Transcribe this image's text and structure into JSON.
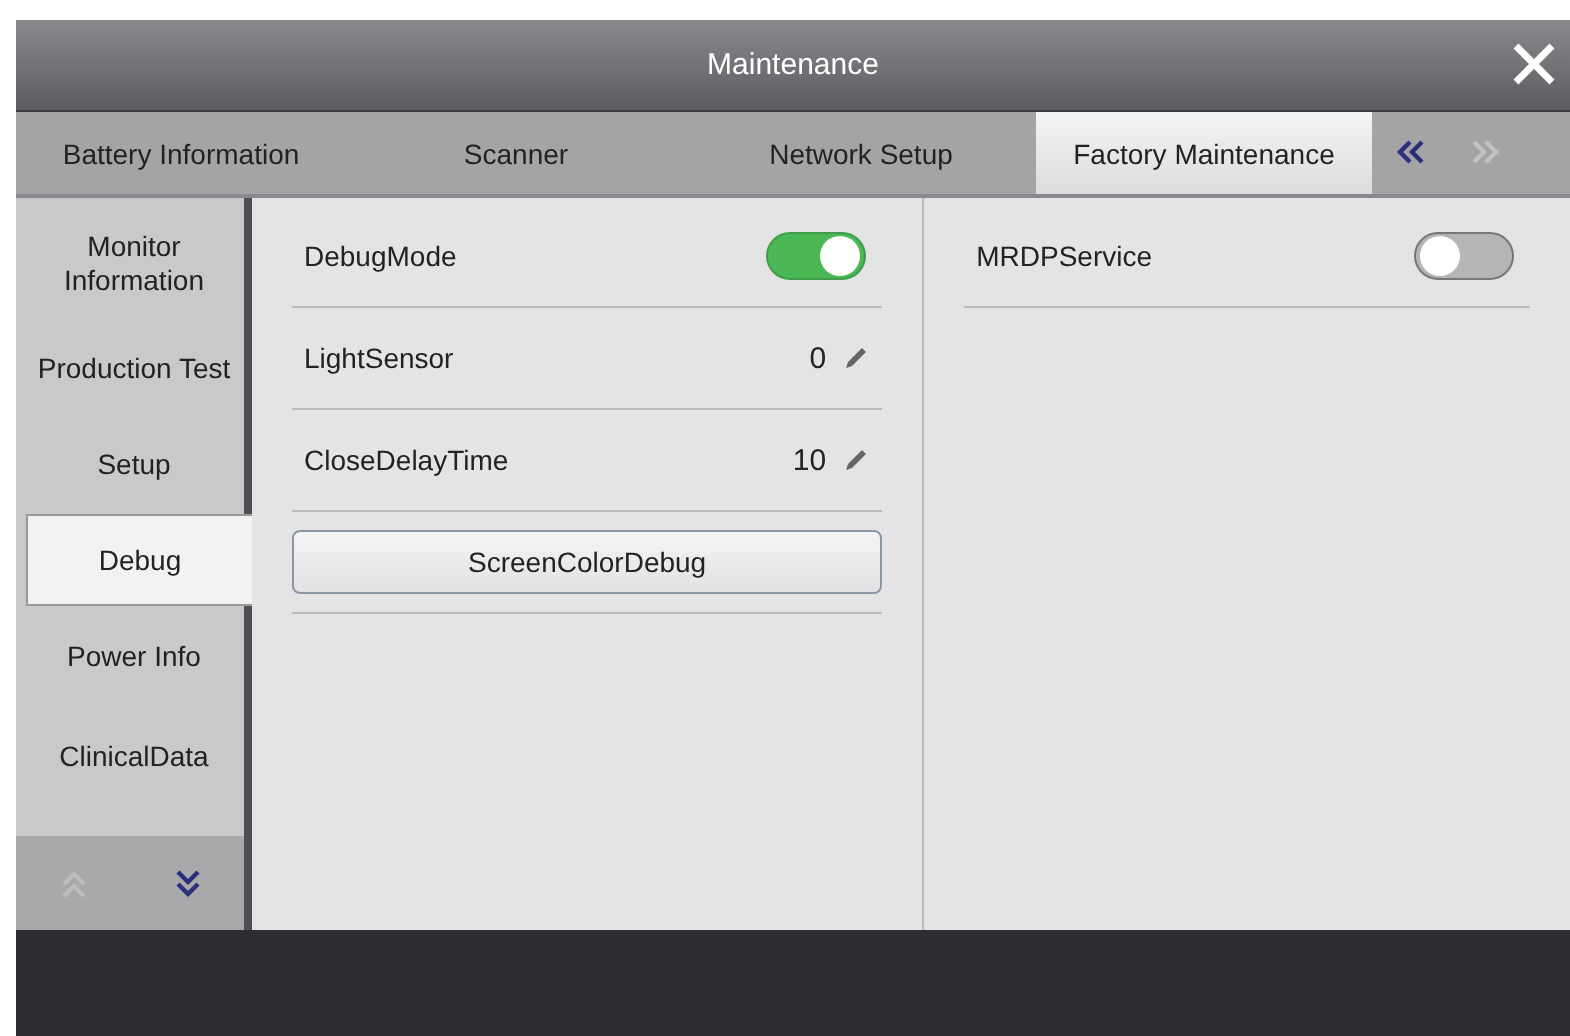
{
  "window": {
    "title": "Maintenance"
  },
  "tabs": [
    {
      "label": "Battery Information",
      "selected": false
    },
    {
      "label": "Scanner",
      "selected": false
    },
    {
      "label": "Network Setup",
      "selected": false
    },
    {
      "label": "Factory Maintenance",
      "selected": true
    }
  ],
  "tab_scroll": [
    {
      "kind": "left",
      "disabled": false
    },
    {
      "kind": "right",
      "disabled": true
    }
  ],
  "sidebar": {
    "items": [
      {
        "label": "Monitor Information",
        "selected": false
      },
      {
        "label": "Production Test",
        "selected": false
      },
      {
        "label": "Setup",
        "selected": false
      },
      {
        "label": "Debug",
        "selected": true
      },
      {
        "label": "Power Info",
        "selected": false
      },
      {
        "label": "ClinicalData",
        "selected": false
      }
    ],
    "scroll": [
      {
        "kind": "up",
        "disabled": true
      },
      {
        "kind": "down",
        "disabled": false
      }
    ]
  },
  "left_panel": [
    {
      "kind": "toggle",
      "label": "DebugMode",
      "on": true
    },
    {
      "kind": "value",
      "label": "LightSensor",
      "value": "0"
    },
    {
      "kind": "value",
      "label": "CloseDelayTime",
      "value": "10"
    },
    {
      "kind": "button",
      "label": "ScreenColorDebug"
    }
  ],
  "right_panel": [
    {
      "kind": "toggle",
      "label": "MRDPService",
      "on": false
    }
  ]
}
